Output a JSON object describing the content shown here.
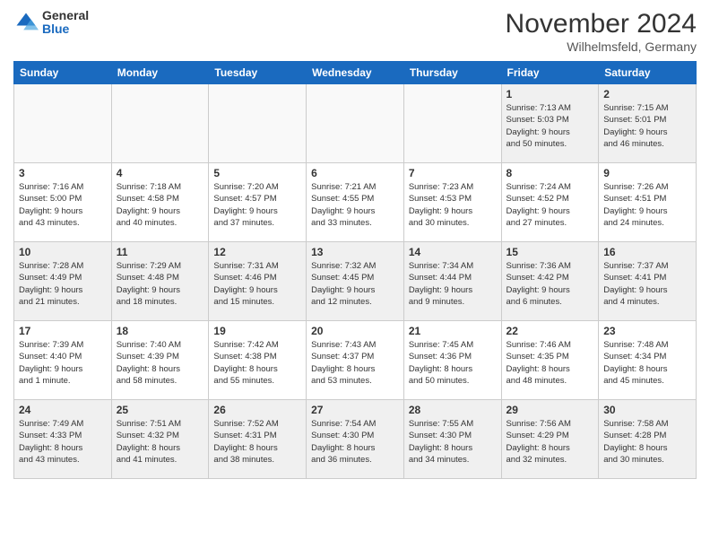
{
  "logo": {
    "general": "General",
    "blue": "Blue"
  },
  "title": "November 2024",
  "location": "Wilhelmsfeld, Germany",
  "days_of_week": [
    "Sunday",
    "Monday",
    "Tuesday",
    "Wednesday",
    "Thursday",
    "Friday",
    "Saturday"
  ],
  "weeks": [
    [
      {
        "day": "",
        "info": ""
      },
      {
        "day": "",
        "info": ""
      },
      {
        "day": "",
        "info": ""
      },
      {
        "day": "",
        "info": ""
      },
      {
        "day": "",
        "info": ""
      },
      {
        "day": "1",
        "info": "Sunrise: 7:13 AM\nSunset: 5:03 PM\nDaylight: 9 hours\nand 50 minutes."
      },
      {
        "day": "2",
        "info": "Sunrise: 7:15 AM\nSunset: 5:01 PM\nDaylight: 9 hours\nand 46 minutes."
      }
    ],
    [
      {
        "day": "3",
        "info": "Sunrise: 7:16 AM\nSunset: 5:00 PM\nDaylight: 9 hours\nand 43 minutes."
      },
      {
        "day": "4",
        "info": "Sunrise: 7:18 AM\nSunset: 4:58 PM\nDaylight: 9 hours\nand 40 minutes."
      },
      {
        "day": "5",
        "info": "Sunrise: 7:20 AM\nSunset: 4:57 PM\nDaylight: 9 hours\nand 37 minutes."
      },
      {
        "day": "6",
        "info": "Sunrise: 7:21 AM\nSunset: 4:55 PM\nDaylight: 9 hours\nand 33 minutes."
      },
      {
        "day": "7",
        "info": "Sunrise: 7:23 AM\nSunset: 4:53 PM\nDaylight: 9 hours\nand 30 minutes."
      },
      {
        "day": "8",
        "info": "Sunrise: 7:24 AM\nSunset: 4:52 PM\nDaylight: 9 hours\nand 27 minutes."
      },
      {
        "day": "9",
        "info": "Sunrise: 7:26 AM\nSunset: 4:51 PM\nDaylight: 9 hours\nand 24 minutes."
      }
    ],
    [
      {
        "day": "10",
        "info": "Sunrise: 7:28 AM\nSunset: 4:49 PM\nDaylight: 9 hours\nand 21 minutes."
      },
      {
        "day": "11",
        "info": "Sunrise: 7:29 AM\nSunset: 4:48 PM\nDaylight: 9 hours\nand 18 minutes."
      },
      {
        "day": "12",
        "info": "Sunrise: 7:31 AM\nSunset: 4:46 PM\nDaylight: 9 hours\nand 15 minutes."
      },
      {
        "day": "13",
        "info": "Sunrise: 7:32 AM\nSunset: 4:45 PM\nDaylight: 9 hours\nand 12 minutes."
      },
      {
        "day": "14",
        "info": "Sunrise: 7:34 AM\nSunset: 4:44 PM\nDaylight: 9 hours\nand 9 minutes."
      },
      {
        "day": "15",
        "info": "Sunrise: 7:36 AM\nSunset: 4:42 PM\nDaylight: 9 hours\nand 6 minutes."
      },
      {
        "day": "16",
        "info": "Sunrise: 7:37 AM\nSunset: 4:41 PM\nDaylight: 9 hours\nand 4 minutes."
      }
    ],
    [
      {
        "day": "17",
        "info": "Sunrise: 7:39 AM\nSunset: 4:40 PM\nDaylight: 9 hours\nand 1 minute."
      },
      {
        "day": "18",
        "info": "Sunrise: 7:40 AM\nSunset: 4:39 PM\nDaylight: 8 hours\nand 58 minutes."
      },
      {
        "day": "19",
        "info": "Sunrise: 7:42 AM\nSunset: 4:38 PM\nDaylight: 8 hours\nand 55 minutes."
      },
      {
        "day": "20",
        "info": "Sunrise: 7:43 AM\nSunset: 4:37 PM\nDaylight: 8 hours\nand 53 minutes."
      },
      {
        "day": "21",
        "info": "Sunrise: 7:45 AM\nSunset: 4:36 PM\nDaylight: 8 hours\nand 50 minutes."
      },
      {
        "day": "22",
        "info": "Sunrise: 7:46 AM\nSunset: 4:35 PM\nDaylight: 8 hours\nand 48 minutes."
      },
      {
        "day": "23",
        "info": "Sunrise: 7:48 AM\nSunset: 4:34 PM\nDaylight: 8 hours\nand 45 minutes."
      }
    ],
    [
      {
        "day": "24",
        "info": "Sunrise: 7:49 AM\nSunset: 4:33 PM\nDaylight: 8 hours\nand 43 minutes."
      },
      {
        "day": "25",
        "info": "Sunrise: 7:51 AM\nSunset: 4:32 PM\nDaylight: 8 hours\nand 41 minutes."
      },
      {
        "day": "26",
        "info": "Sunrise: 7:52 AM\nSunset: 4:31 PM\nDaylight: 8 hours\nand 38 minutes."
      },
      {
        "day": "27",
        "info": "Sunrise: 7:54 AM\nSunset: 4:30 PM\nDaylight: 8 hours\nand 36 minutes."
      },
      {
        "day": "28",
        "info": "Sunrise: 7:55 AM\nSunset: 4:30 PM\nDaylight: 8 hours\nand 34 minutes."
      },
      {
        "day": "29",
        "info": "Sunrise: 7:56 AM\nSunset: 4:29 PM\nDaylight: 8 hours\nand 32 minutes."
      },
      {
        "day": "30",
        "info": "Sunrise: 7:58 AM\nSunset: 4:28 PM\nDaylight: 8 hours\nand 30 minutes."
      }
    ]
  ]
}
